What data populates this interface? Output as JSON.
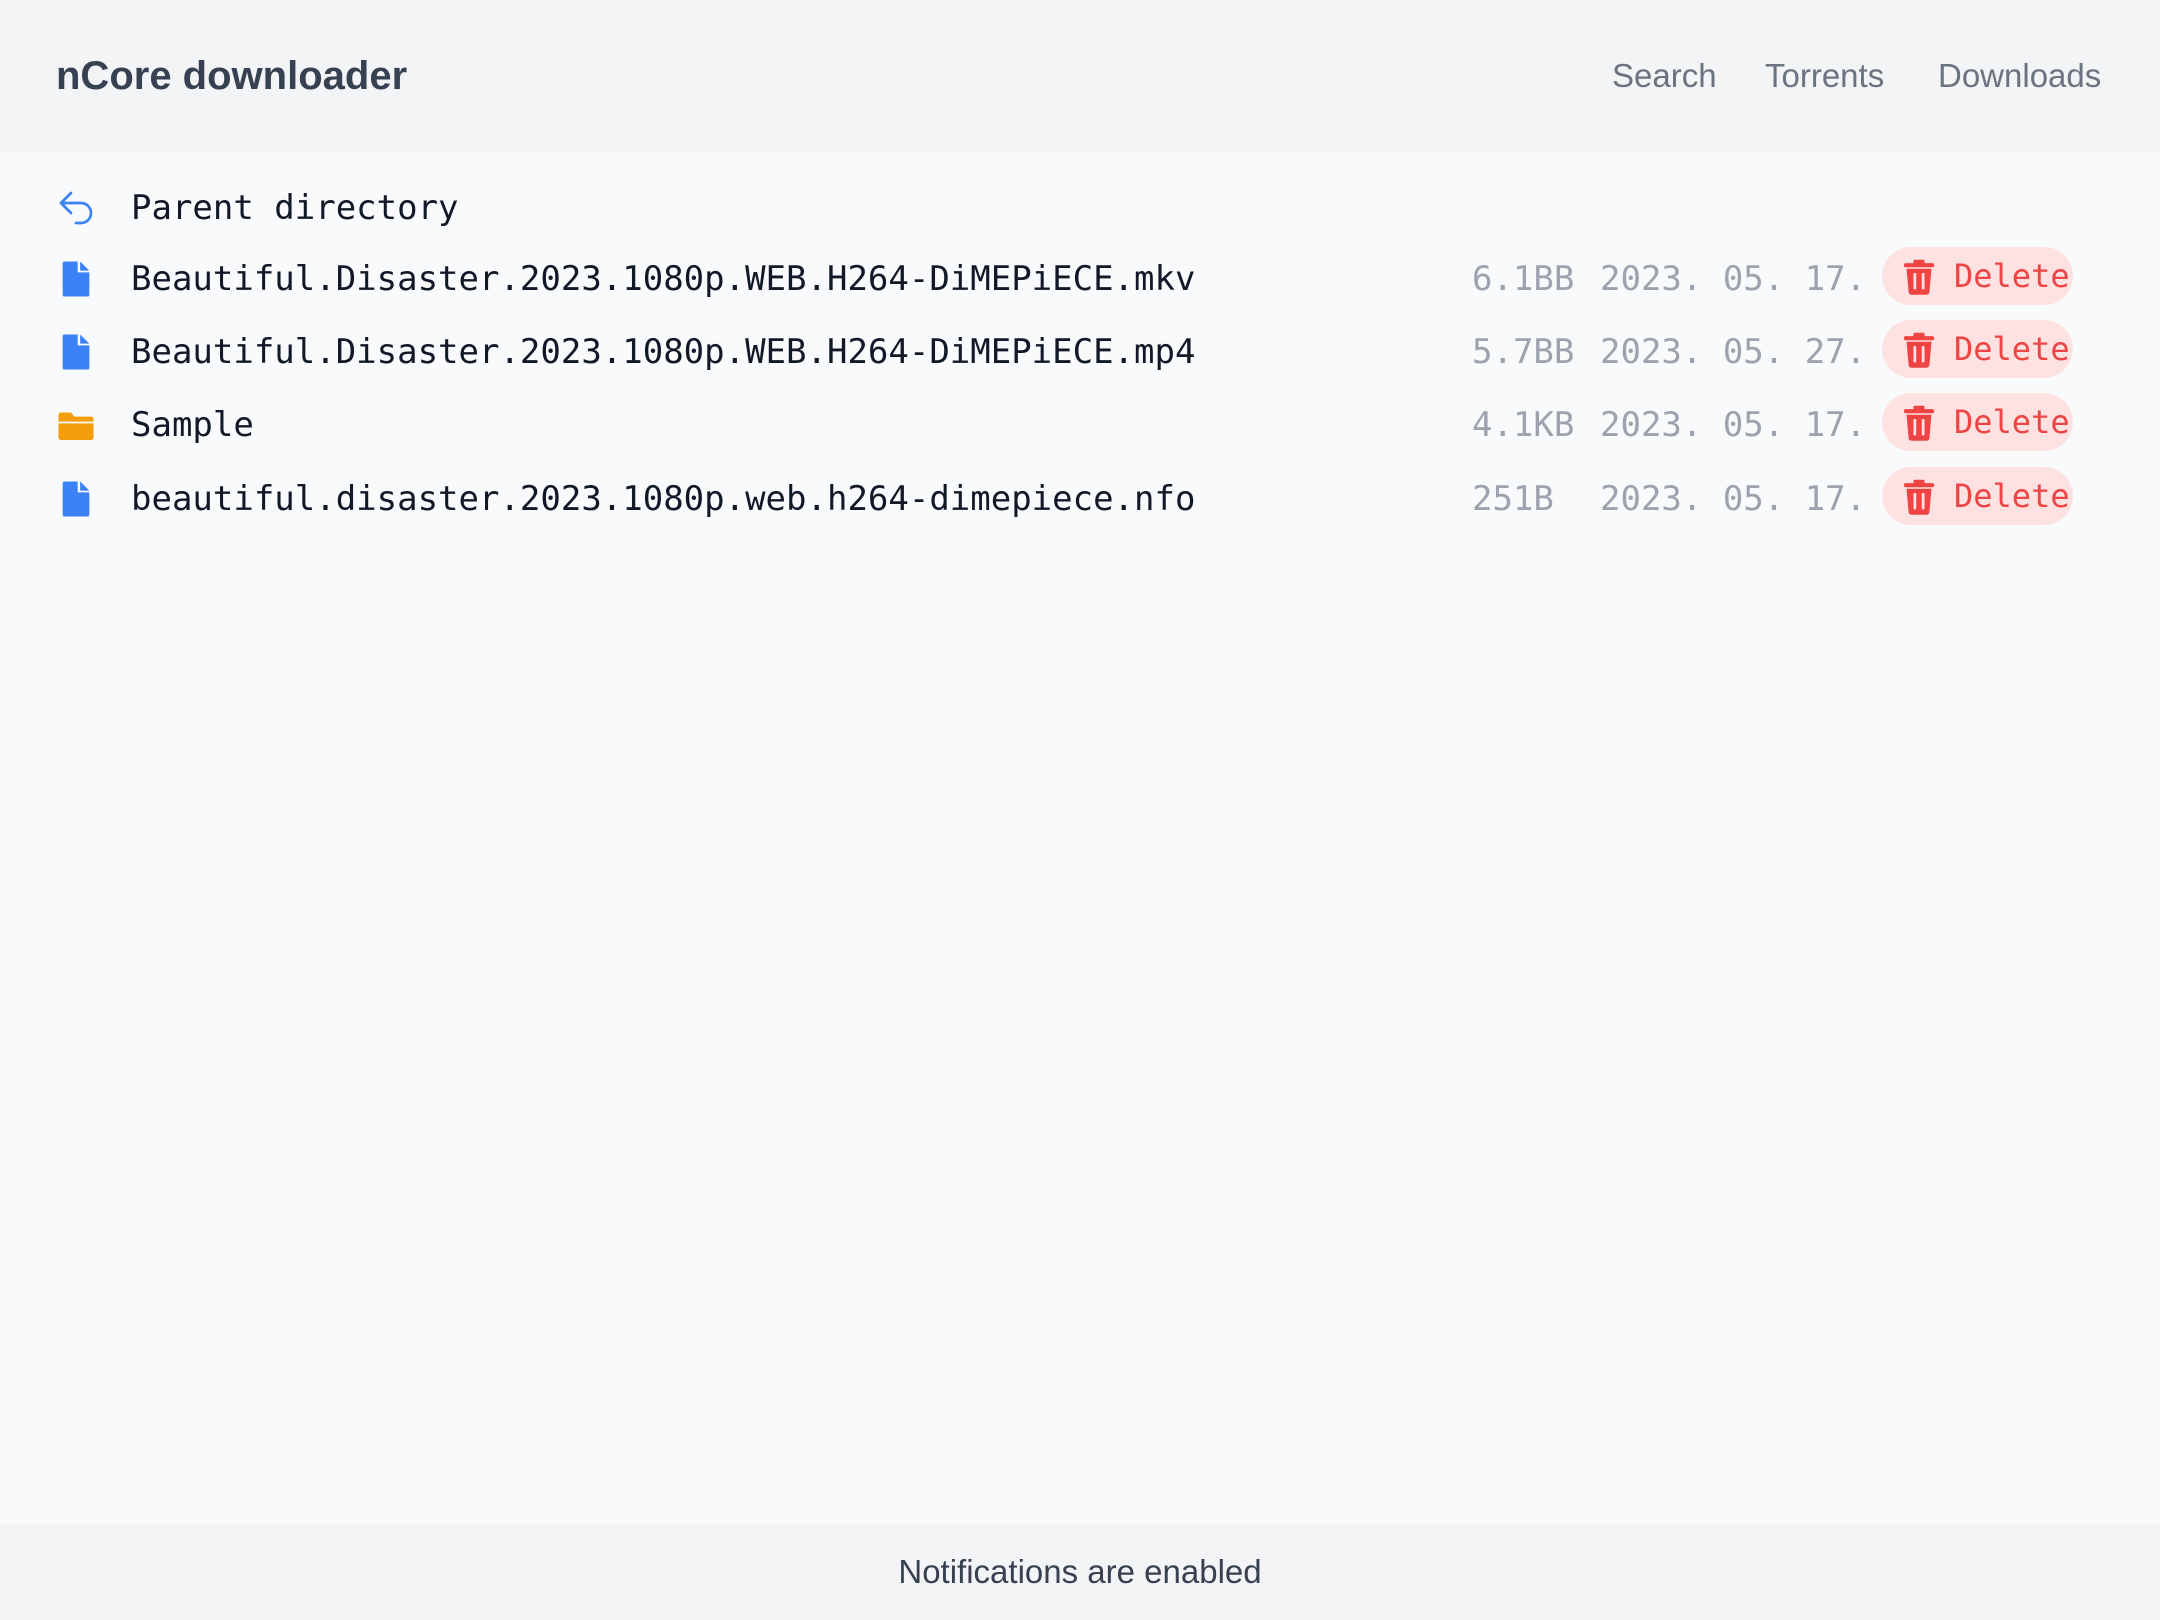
{
  "header": {
    "title": "nCore downloader",
    "nav": {
      "search": "Search",
      "torrents": "Torrents",
      "downloads": "Downloads"
    }
  },
  "listing": {
    "parent": {
      "label": "Parent directory",
      "icon": "back-arrow-icon"
    },
    "delete_label": "Delete",
    "entries": [
      {
        "name": "Beautiful.Disaster.2023.1080p.WEB.H264-DiMEPiECE.mkv",
        "size": "6.1BB",
        "date": "2023. 05. 17.",
        "type": "file",
        "icon": "file-icon"
      },
      {
        "name": "Beautiful.Disaster.2023.1080p.WEB.H264-DiMEPiECE.mp4",
        "size": "5.7BB",
        "date": "2023. 05. 27.",
        "type": "file",
        "icon": "file-icon"
      },
      {
        "name": "Sample",
        "size": "4.1KB",
        "date": "2023. 05. 17.",
        "type": "folder",
        "icon": "folder-icon"
      },
      {
        "name": "beautiful.disaster.2023.1080p.web.h264-dimepiece.nfo",
        "size": "251B",
        "date": "2023. 05. 17.",
        "type": "file",
        "icon": "file-icon"
      }
    ]
  },
  "footer": {
    "status": "Notifications are enabled"
  },
  "colors": {
    "file_icon": "#3b82f6",
    "folder_icon": "#f59e0b",
    "delete_text": "#ef4444",
    "delete_bg": "#fee2e2",
    "muted_text": "#9ca3af"
  }
}
